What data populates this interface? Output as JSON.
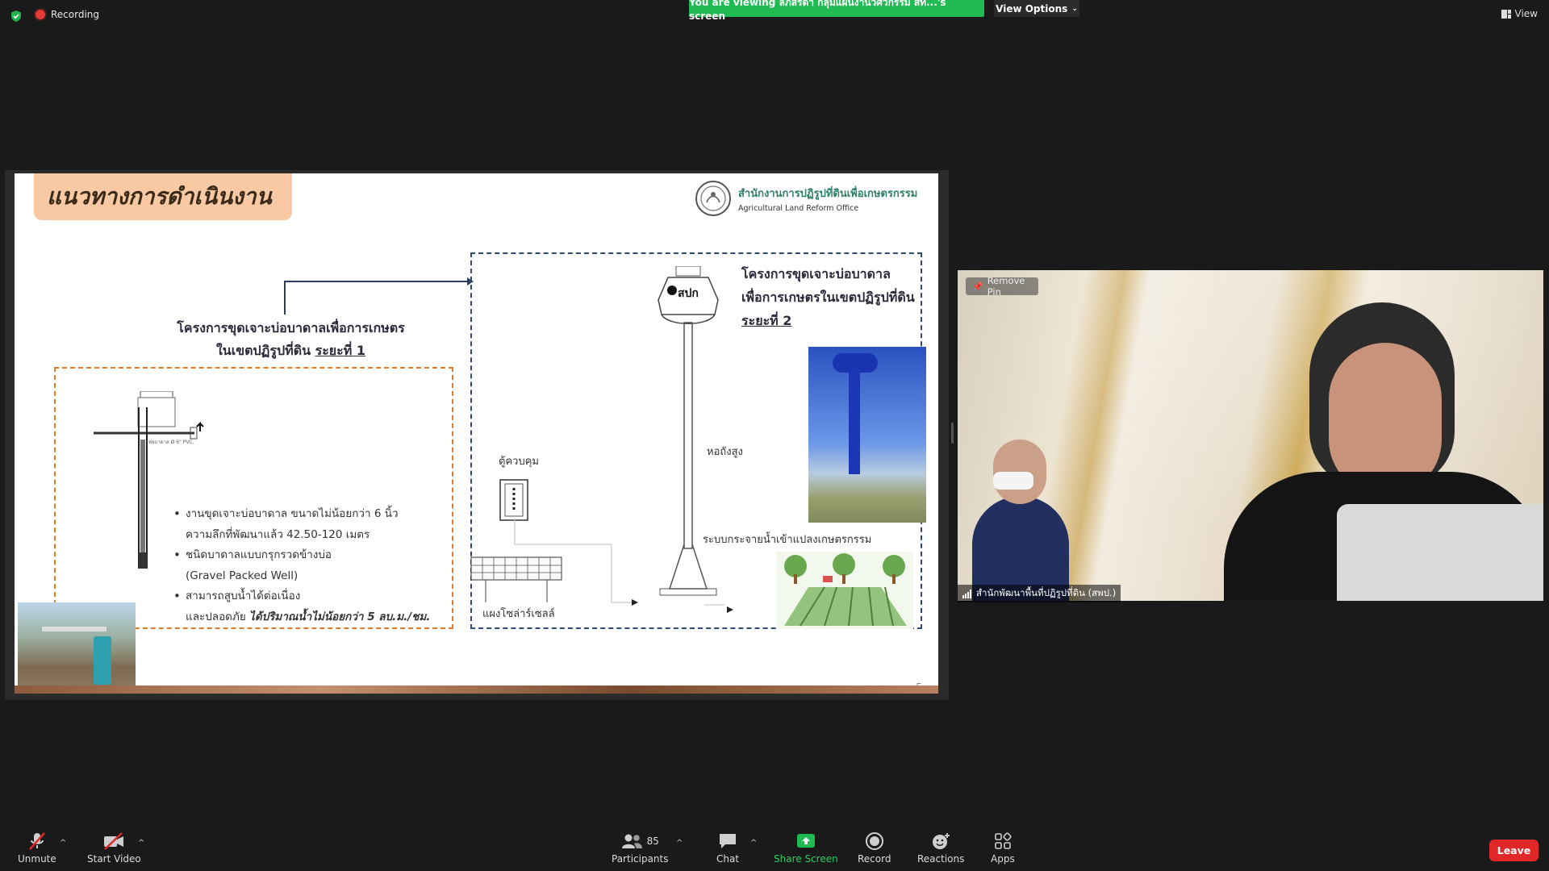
{
  "top": {
    "recording_label": "Recording",
    "viewing_banner": "You are viewing ลภัสรดา กลุ่มแผนงานวิศวกรรม สท...'s screen",
    "view_options_label": "View Options",
    "view_label": "View"
  },
  "slide": {
    "title": "แนวทางการดำเนินงาน",
    "org_thai": "สำนักงานการปฏิรูปที่ดินเพื่อเกษตรกรรม",
    "org_english": "Agricultural Land Reform Office",
    "phase1_line1": "โครงการขุดเจาะบ่อบาดาลเพื่อการเกษตร",
    "phase1_line2_prefix": "ในเขตปฏิรูปที่ดิน ",
    "phase1_line2_underlined": "ระยะที่ 1",
    "phase2_line1": "โครงการขุดเจาะบ่อบาดาล",
    "phase2_line2": "เพื่อการเกษตรในเขตปฏิรูปที่ดิน",
    "phase2_line3": "ระยะที่ 2",
    "bullets": {
      "b1_l1": "งานขุดเจาะบ่อบาดาล ขนาดไม่น้อยกว่า 6 นิ้ว",
      "b1_l2": "ความลึกที่พัฒนาแล้ว 42.50-120 เมตร",
      "b2_l1": "ชนิดบาดาลแบบกรุกรวดข้างบ่อ",
      "b2_l2": "(Gravel Packed Well)",
      "b3_l1": "สามารถสูบน้ำได้ต่อเนื่อง",
      "b3_l2_prefix": "และปลอดภัย ",
      "b3_l2_emph": "ได้ปริมาณน้ำไม่น้อยกว่า 5 ลบ.ม./ชม."
    },
    "label_control_cabinet": "ตู้ควบคุม",
    "label_high_tower": "หอถังสูง",
    "label_solar_panel": "แผงโซล่าร์เซลล์",
    "label_distribution": "ระบบกระจายน้ำเข้าแปลงเกษตรกรรม",
    "tower_logo": "สปก",
    "page_number": "5"
  },
  "video": {
    "remove_pin_label": "Remove Pin",
    "participant_name": "สำนักพัฒนาพื้นที่ปฏิรูปที่ดิน (สพป.)"
  },
  "toolbar": {
    "unmute": "Unmute",
    "start_video": "Start Video",
    "participants": "Participants",
    "participants_count": "85",
    "chat": "Chat",
    "share_screen": "Share Screen",
    "record": "Record",
    "reactions": "Reactions",
    "apps": "Apps",
    "leave": "Leave"
  },
  "colors": {
    "banner_green": "#1fba52",
    "leave_red": "#e02828",
    "title_peach": "#f8c9a2",
    "box_orange": "#e07b2c",
    "box_blue": "#2b4a7a"
  }
}
